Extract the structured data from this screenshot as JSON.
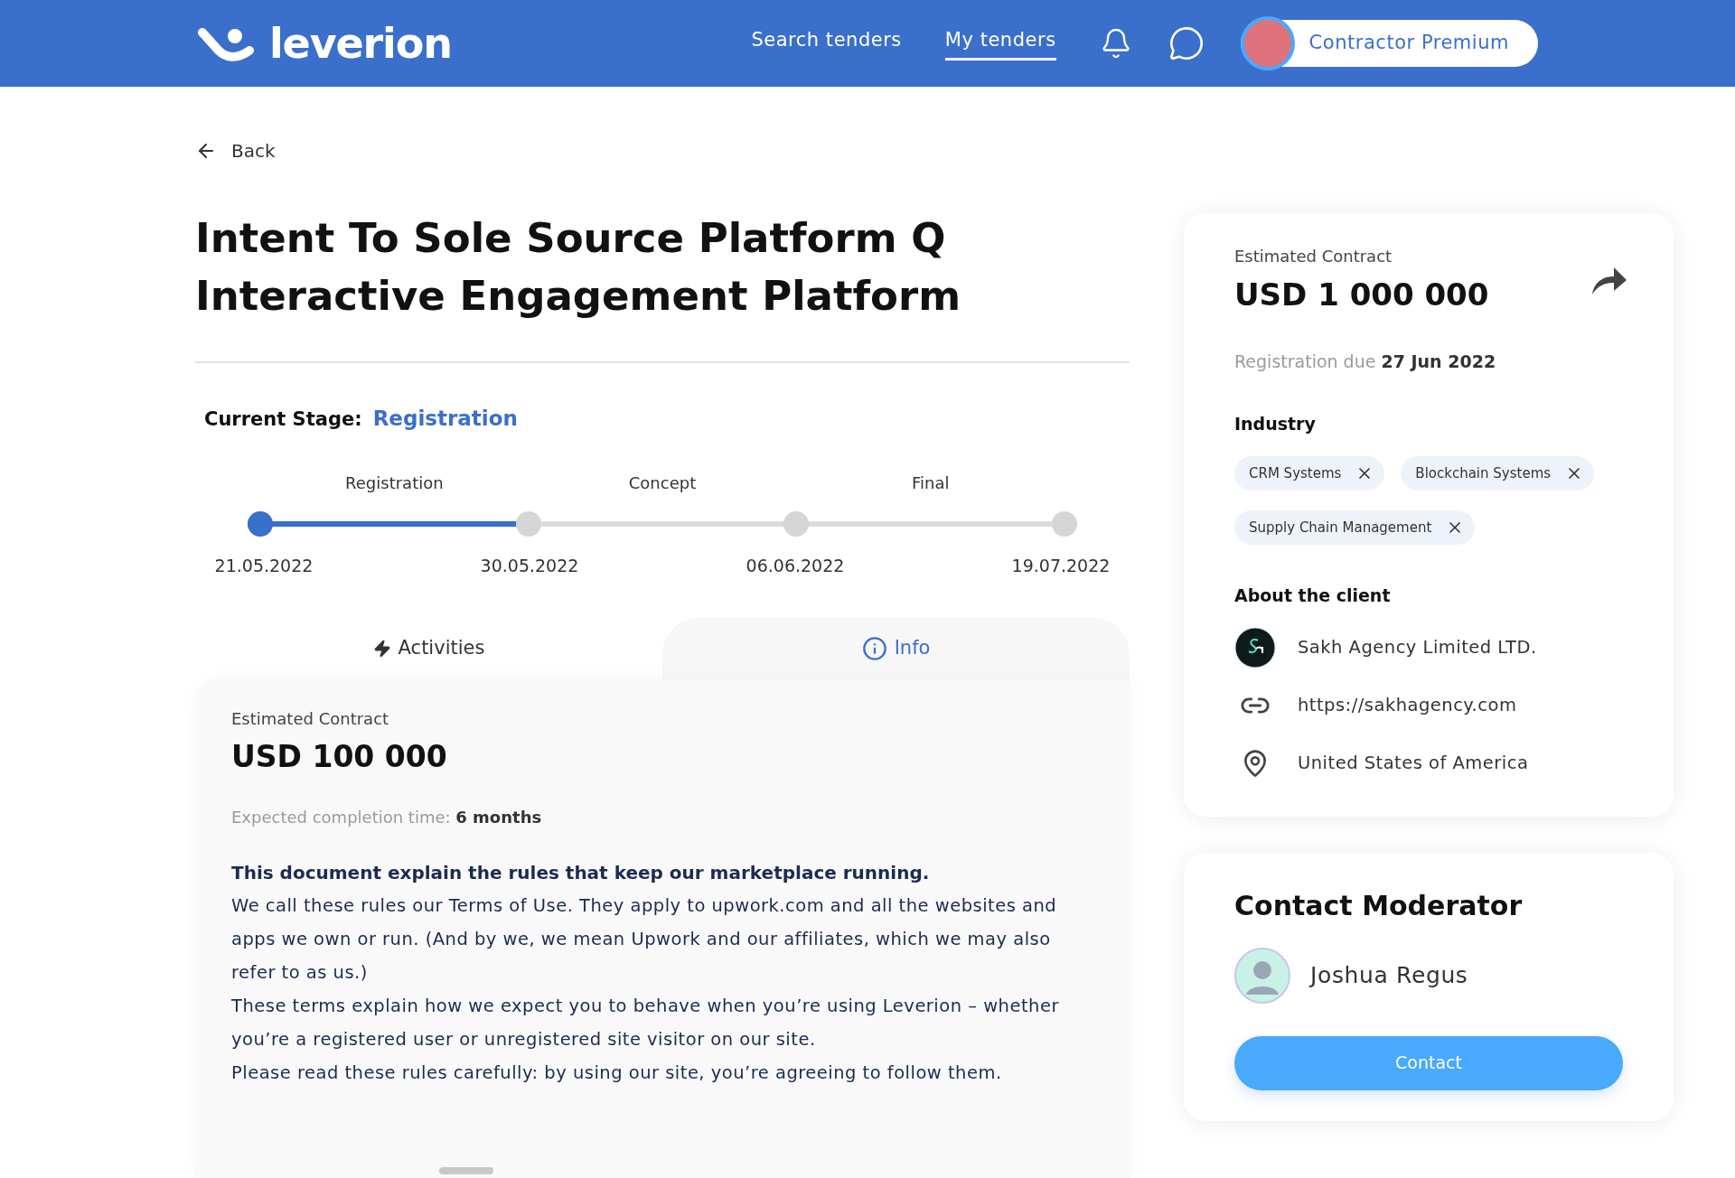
{
  "header": {
    "logo": "leverion",
    "nav": [
      {
        "label": "Search tenders",
        "selected": false
      },
      {
        "label": "My tenders",
        "selected": true
      }
    ],
    "profile": {
      "label": "Contractor Premium"
    }
  },
  "back": "Back",
  "title": "Intent To Sole Source Platform Q Interactive Engagement Platform",
  "current_stage": {
    "label": "Current Stage:",
    "value": "Registration"
  },
  "stepper": {
    "stages": [
      "Registration",
      "Concept",
      "Final"
    ],
    "level": 0.333,
    "points": [
      {
        "date": "21.05.2022",
        "reached": true
      },
      {
        "date": "30.05.2022",
        "reached": false
      },
      {
        "date": "06.06.2022",
        "reached": false
      },
      {
        "date": "19.07.2022",
        "reached": false
      }
    ]
  },
  "tabs": [
    {
      "kind": "activity",
      "label": "Activities",
      "selected": false
    },
    {
      "kind": "info",
      "label": "Info",
      "selected": true
    }
  ],
  "info": {
    "estimate_label": "Estimated Contract",
    "estimate": "USD 100 000",
    "completion_label": "Expected completion time:",
    "completion": "6 months",
    "lead": "This document explain the rules that keep our marketplace running.",
    "paragraphs": [
      "We call these rules our Terms of Use. They apply to upwork.com and all the websites and apps we own or run. (And by we, we mean Upwork and our affiliates, which we may also refer to as us.)",
      "These terms explain how we expect you to behave when you’re using Leverion – whether you’re a registered user or unregistered site visitor on our site.",
      "Please read these rules carefully: by using our site, you’re agreeing to follow them."
    ]
  },
  "summary": {
    "estimate_label": "Estimated Contract",
    "estimate": "USD 1 000 000",
    "due_label": "Registration due",
    "due": "27 Jun 2022",
    "industry_label": "Industry",
    "tags": [
      "CRM Systems",
      "Blockchain Systems",
      "Supply Chain Management"
    ],
    "client_label": "About the client",
    "client": [
      {
        "kind": "company",
        "text": "Sakh Agency Limited LTD."
      },
      {
        "kind": "link",
        "text": "https://sakhagency.com"
      },
      {
        "kind": "location",
        "text": "United States of America"
      }
    ]
  },
  "moderator": {
    "title": "Contact Moderator",
    "name": "Joshua Regus",
    "button": "Contact"
  }
}
